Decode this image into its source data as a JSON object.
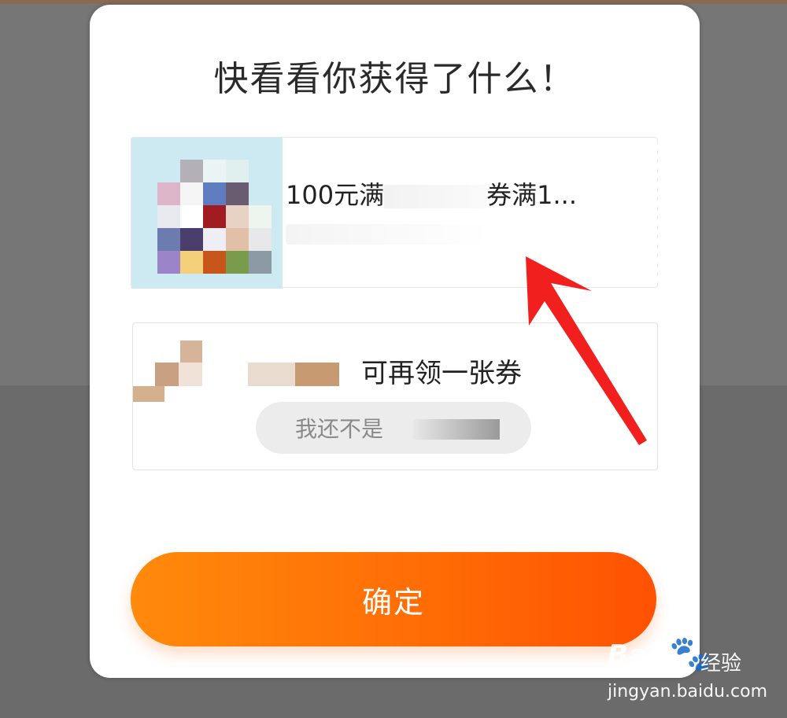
{
  "modal": {
    "title": "快看看你获得了什么！",
    "coupon": {
      "title_start": "100元",
      "title_middle": "满",
      "title_end": "券满1..."
    },
    "member": {
      "text": "可再领一张券",
      "button_label": "我还不是"
    },
    "confirm_label": "确定"
  },
  "watermark": {
    "brand": "Bai",
    "brand_suffix": "du",
    "cn": "经验",
    "url": "jingyan.baidu.com"
  },
  "colors": {
    "confirm_start": "#ff8a0c",
    "confirm_end": "#ff5203",
    "arrow": "#f21f1f"
  }
}
